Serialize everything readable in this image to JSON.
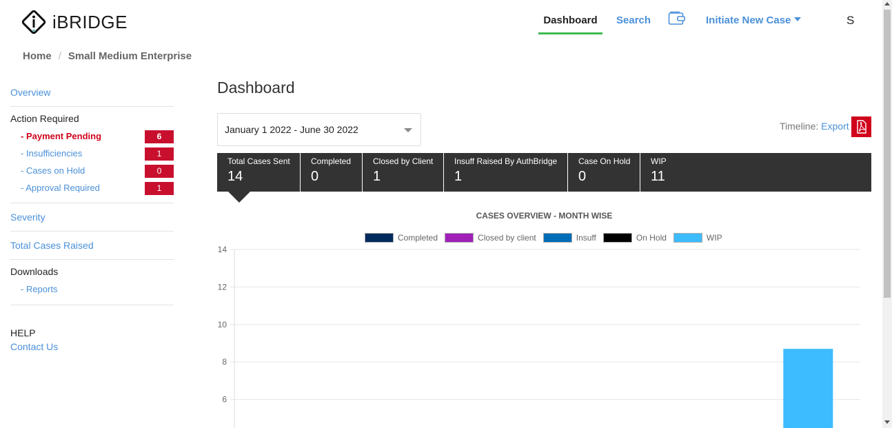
{
  "header": {
    "logo_text": "iBRIDGE",
    "nav": {
      "dashboard": "Dashboard",
      "search": "Search",
      "initiate": "Initiate New Case",
      "user_initial": "S"
    }
  },
  "breadcrumb": {
    "home": "Home",
    "current": "Small Medium Enterprise"
  },
  "sidebar": {
    "overview": "Overview",
    "action_required": "Action Required",
    "action_items": [
      {
        "label": "- Payment Pending",
        "count": "6"
      },
      {
        "label": "- Insufficiencies",
        "count": "1"
      },
      {
        "label": "- Cases on Hold",
        "count": "0"
      },
      {
        "label": "- Approval Required",
        "count": "1"
      }
    ],
    "severity": "Severity",
    "total_cases_raised": "Total Cases Raised",
    "downloads": "Downloads",
    "reports": "- Reports",
    "help": "HELP",
    "contact_us": "Contact Us"
  },
  "main": {
    "title": "Dashboard",
    "date_range": "January 1 2022 - June 30 2022",
    "timeline_label": "Timeline:",
    "export_label": "Export",
    "stats": [
      {
        "label": "Total Cases Sent",
        "value": "14"
      },
      {
        "label": "Completed",
        "value": "0"
      },
      {
        "label": "Closed by Client",
        "value": "1"
      },
      {
        "label": "Insuff Raised By AuthBridge",
        "value": "1"
      },
      {
        "label": "Case On Hold",
        "value": "0"
      },
      {
        "label": "WIP",
        "value": "11"
      }
    ]
  },
  "colors": {
    "accent_blue": "#4a90d9",
    "alert_red": "#c8102e",
    "nav_active_underline": "#3fb950",
    "stats_bg": "#333333"
  },
  "chart_data": {
    "type": "bar",
    "title": "CASES OVERVIEW - MONTH WISE",
    "legend": [
      {
        "name": "Completed",
        "color": "#002b5c"
      },
      {
        "name": "Closed by client",
        "color": "#a020b8"
      },
      {
        "name": "Insuff",
        "color": "#006db8"
      },
      {
        "name": "On Hold",
        "color": "#000000"
      },
      {
        "name": "WIP",
        "color": "#3dbcff"
      }
    ],
    "y_ticks": [
      "14",
      "12",
      "10",
      "8",
      "6"
    ],
    "ylim": [
      0,
      14
    ],
    "grid": true,
    "categories_count": 6,
    "series": [
      {
        "name": "WIP",
        "values": [
          0,
          0,
          0,
          0,
          0,
          8.7
        ]
      }
    ]
  }
}
